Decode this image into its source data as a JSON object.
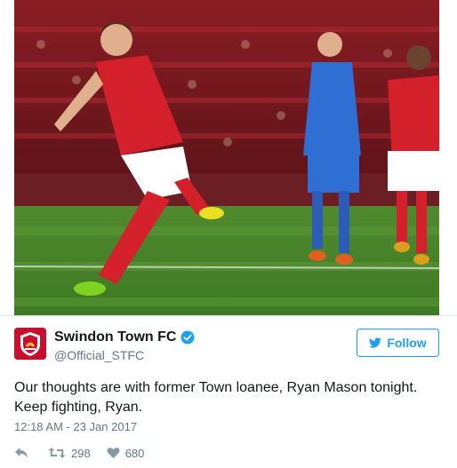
{
  "tweet": {
    "author": {
      "display_name": "Swindon Town FC",
      "screen_name": "@Official_STFC",
      "verified": true,
      "avatar_icon": "club-crest-icon"
    },
    "follow_label": "Follow",
    "text": "Our thoughts are with former Town loanee, Ryan Mason tonight. Keep fighting, Ryan.",
    "timestamp": "12:18 AM - 23 Jan 2017",
    "retweet_count": "298",
    "like_count": "680"
  },
  "colors": {
    "twitter_blue": "#1da1f2",
    "club_red": "#c8102e",
    "muted_text": "#657786"
  },
  "icons": {
    "verified": "verified-badge-icon",
    "follow": "bird-icon",
    "reply": "reply-icon",
    "retweet": "retweet-icon",
    "like": "heart-icon"
  }
}
